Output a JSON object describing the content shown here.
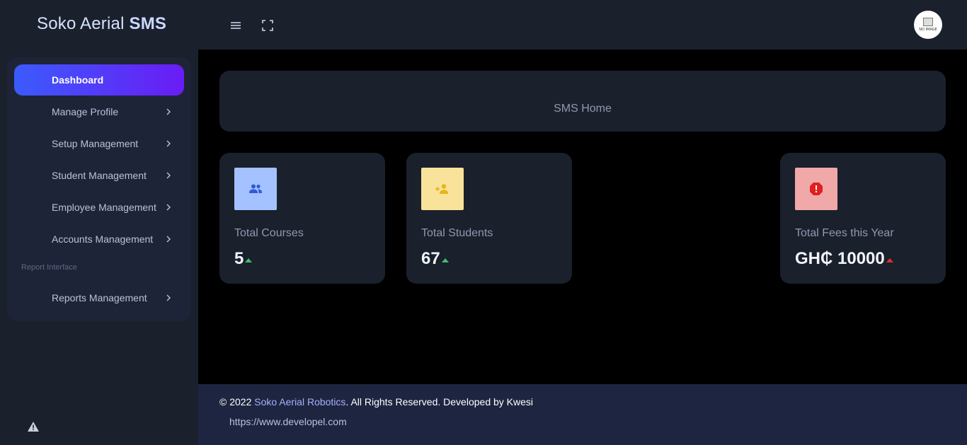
{
  "header": {
    "brand_light": "Soko Aerial",
    "brand_bold": "SMS",
    "menu_icon": "menu-icon",
    "fullscreen_icon": "fullscreen-icon",
    "avatar_text": "NO IMAGE"
  },
  "sidebar": {
    "items": [
      {
        "label": "Dashboard"
      },
      {
        "label": "Manage Profile"
      },
      {
        "label": "Setup Management"
      },
      {
        "label": "Student Management"
      },
      {
        "label": "Employee Management"
      },
      {
        "label": "Accounts Management"
      }
    ],
    "section_label": "Report Interface",
    "report_item": {
      "label": "Reports Management"
    },
    "warning_icon": "warning-icon"
  },
  "main": {
    "breadcrumb": "SMS Home",
    "stats": [
      {
        "title": "Total Courses",
        "value": "5",
        "icon": "people-icon",
        "icon_bg": "#a4c2ff",
        "icon_color": "#2f5bd6",
        "trend_color": "#3fbf6f"
      },
      {
        "title": "Total Students",
        "value": "67",
        "icon": "add-person-icon",
        "icon_bg": "#f9e39b",
        "icon_color": "#e8b41a",
        "trend_color": "#3fbf6f"
      },
      {
        "title": "Total Fees this Year",
        "value": "GH₵ 10000",
        "icon": "alert-icon",
        "icon_bg": "#f0a8a8",
        "icon_color": "#e02020",
        "trend_color": "#e03030"
      }
    ]
  },
  "footer": {
    "copyright": "© 2022 ",
    "company": "Soko Aerial Robotics",
    "rights": ". All Rights Reserved. Developed by Kwesi",
    "link": "https://www.developel.com"
  }
}
